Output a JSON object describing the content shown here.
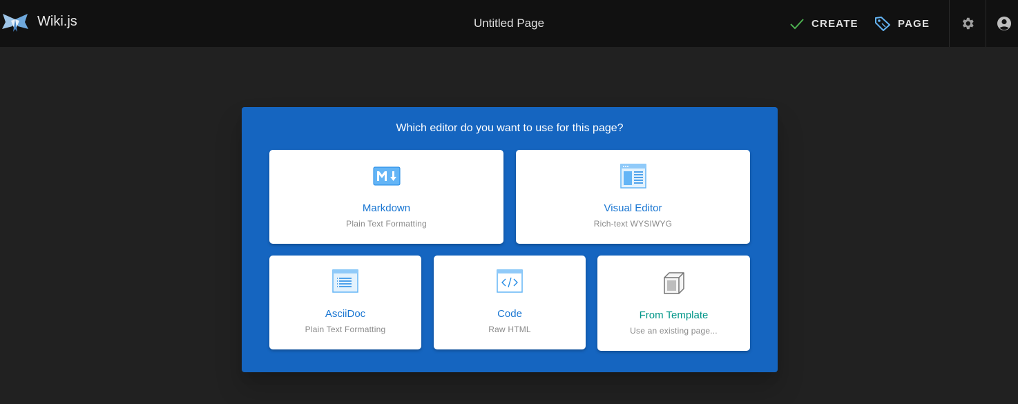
{
  "app": {
    "title": "Wiki.js"
  },
  "header": {
    "page_title": "Untitled Page",
    "create_label": "CREATE",
    "page_label": "PAGE"
  },
  "dialog": {
    "title": "Which editor do you want to use for this page?",
    "editors": [
      {
        "title": "Markdown",
        "subtitle": "Plain Text Formatting",
        "icon": "markdown-icon"
      },
      {
        "title": "Visual Editor",
        "subtitle": "Rich-text WYSIWYG",
        "icon": "visual-editor-icon"
      },
      {
        "title": "AsciiDoc",
        "subtitle": "Plain Text Formatting",
        "icon": "asciidoc-icon"
      },
      {
        "title": "Code",
        "subtitle": "Raw HTML",
        "icon": "code-icon"
      },
      {
        "title": "From Template",
        "subtitle": "Use an existing page...",
        "icon": "template-cube-icon"
      }
    ]
  },
  "colors": {
    "topbar": "#111111",
    "background": "#212121",
    "dialog": "#1565c0",
    "link_blue": "#1976d2",
    "teal": "#009688",
    "create_check": "#4caf50",
    "page_tag": "#64b5f6"
  }
}
